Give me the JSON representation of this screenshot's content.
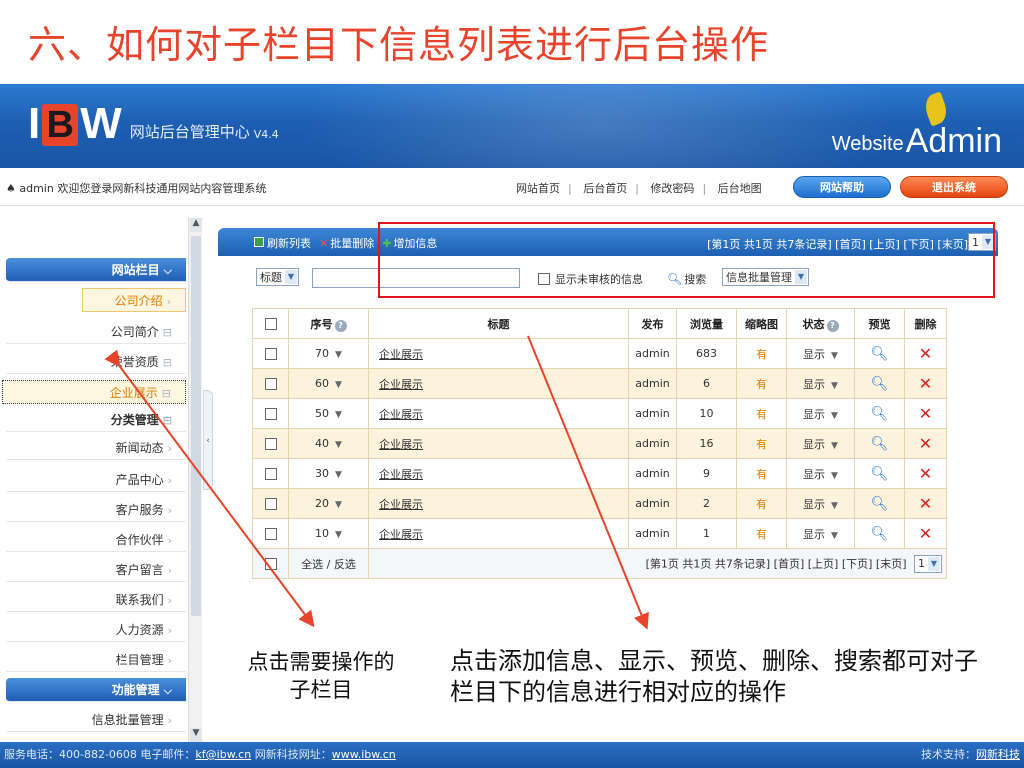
{
  "slide": {
    "title": "六、如何对子栏目下信息列表进行后台操作",
    "annotation_left": "点击需要操作的子栏目",
    "annotation_right": "点击添加信息、显示、预览、删除、搜索都可对子栏目下的信息进行相对应的操作"
  },
  "header": {
    "logo_i": "I",
    "logo_b": "B",
    "logo_w": "W",
    "system_name": "网站后台管理中心",
    "version": "V4.4",
    "brand_website": "Website",
    "brand_admin": "Admin"
  },
  "info_bar": {
    "welcome": "♠ admin 欢迎您登录网新科技通用网站内容管理系统",
    "links": [
      "网站首页",
      "后台首页",
      "修改密码",
      "后台地图"
    ],
    "help_button": "网站帮助",
    "exit_button": "退出系统"
  },
  "sidebar": {
    "items": [
      {
        "label": "网站栏目",
        "icon": "chevron-down-icon",
        "style": "head"
      },
      {
        "label": "公司介绍",
        "icon": "chevron-right-icon",
        "style": "active"
      },
      {
        "label": "公司简介",
        "icon": "minus-box-icon",
        "style": "normal"
      },
      {
        "label": "荣誉资质",
        "icon": "minus-box-icon",
        "style": "normal"
      },
      {
        "label": "企业展示",
        "icon": "minus-box-icon",
        "style": "dotted"
      },
      {
        "label": "分类管理",
        "icon": "minus-box-icon",
        "style": "bold"
      },
      {
        "label": "新闻动态",
        "icon": "chevron-right-icon",
        "style": "normal"
      },
      {
        "label": "产品中心",
        "icon": "chevron-right-icon",
        "style": "normal"
      },
      {
        "label": "客户服务",
        "icon": "chevron-right-icon",
        "style": "normal"
      },
      {
        "label": "合作伙伴",
        "icon": "chevron-right-icon",
        "style": "normal"
      },
      {
        "label": "客户留言",
        "icon": "chevron-right-icon",
        "style": "normal"
      },
      {
        "label": "联系我们",
        "icon": "chevron-right-icon",
        "style": "normal"
      },
      {
        "label": "人力资源",
        "icon": "chevron-right-icon",
        "style": "normal"
      },
      {
        "label": "栏目管理",
        "icon": "chevron-right-icon",
        "style": "normal"
      },
      {
        "label": "功能管理",
        "icon": "chevron-down-icon",
        "style": "head"
      },
      {
        "label": "信息批量管理",
        "icon": "chevron-right-icon",
        "style": "normal"
      }
    ]
  },
  "toolbar": {
    "refresh": "刷新列表",
    "batch_delete": "批量删除",
    "add_info": "增加信息",
    "pagination": "[第1页 共1页 共7条记录] [首页] [上页] [下页] [末页]",
    "page_select": "1"
  },
  "search": {
    "field_select": "标题",
    "keyword_value": "",
    "unreviewed_label": "显示未审核的信息",
    "search_label": "搜索",
    "batch_select": "信息批量管理"
  },
  "table": {
    "headers": [
      "",
      "序号",
      "标题",
      "发布",
      "浏览量",
      "缩略图",
      "状态",
      "预览",
      "删除"
    ],
    "rows": [
      {
        "order": "70",
        "title": "企业展示",
        "author": "admin",
        "views": "683",
        "thumb": "有",
        "status": "显示"
      },
      {
        "order": "60",
        "title": "企业展示",
        "author": "admin",
        "views": "6",
        "thumb": "有",
        "status": "显示"
      },
      {
        "order": "50",
        "title": "企业展示",
        "author": "admin",
        "views": "10",
        "thumb": "有",
        "status": "显示"
      },
      {
        "order": "40",
        "title": "企业展示",
        "author": "admin",
        "views": "16",
        "thumb": "有",
        "status": "显示"
      },
      {
        "order": "30",
        "title": "企业展示",
        "author": "admin",
        "views": "9",
        "thumb": "有",
        "status": "显示"
      },
      {
        "order": "20",
        "title": "企业展示",
        "author": "admin",
        "views": "2",
        "thumb": "有",
        "status": "显示"
      },
      {
        "order": "10",
        "title": "企业展示",
        "author": "admin",
        "views": "1",
        "thumb": "有",
        "status": "显示"
      }
    ],
    "footer_select": "全选 / 反选",
    "footer_pagination": "[第1页 共1页 共7条记录] [首页] [上页] [下页] [末页]",
    "footer_page_select": "1"
  },
  "status_bar": {
    "left_prefix": "服务电话：400-882-0608 电子邮件：",
    "email": "kf@ibw.cn",
    "left_mid": " 网新科技网址：",
    "website": "www.ibw.cn",
    "right_prefix": "技术支持：",
    "right_link": "网新科技"
  },
  "colors": {
    "slide_title": "#e8432b",
    "header_blue": "#1d5fb2",
    "highlight_red": "#e0141e",
    "row_alt": "#fdf3dc",
    "active_orange": "#e07b00"
  }
}
